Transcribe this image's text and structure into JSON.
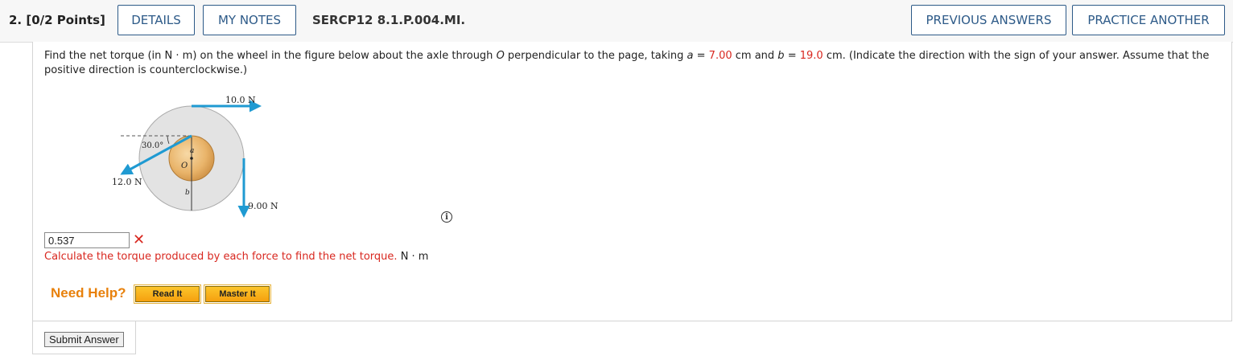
{
  "header": {
    "question_number": "2.",
    "points": "[0/2 Points]",
    "details_label": "DETAILS",
    "my_notes_label": "MY NOTES",
    "problem_code": "SERCP12 8.1.P.004.MI.",
    "previous_answers_label": "PREVIOUS ANSWERS",
    "practice_another_label": "PRACTICE ANOTHER"
  },
  "question": {
    "p1": "Find the net torque (in N · m) on the wheel in the figure below about the axle through ",
    "var_o": "O",
    "p2": " perpendicular to the page, taking ",
    "var_a": "a",
    "p3": " = ",
    "a_value": "7.00",
    "p4": " cm and ",
    "var_b": "b",
    "p5": " = ",
    "b_value": "19.0",
    "p6": " cm. (Indicate the direction with the sign of your answer. Assume that the positive direction is counterclockwise.)"
  },
  "figure": {
    "force_top": "10.0 N",
    "force_left": "12.0 N",
    "force_right": "9.00 N",
    "angle": "30.0°",
    "label_a": "a",
    "label_b": "b",
    "label_o": "O"
  },
  "answer": {
    "value": "0.537",
    "status": "incorrect",
    "feedback": "Calculate the torque produced by each force to find the net torque.",
    "unit": "N · m"
  },
  "help": {
    "label": "Need Help?",
    "read_it": "Read It",
    "master_it": "Master It"
  },
  "submit_label": "Submit Answer",
  "icons": {
    "info": "info-icon",
    "incorrect": "x-mark-icon"
  },
  "colors": {
    "accent_blue": "#2d5a88",
    "error_red": "#d8271f",
    "help_orange": "#e8810c",
    "arrow_blue": "#1f9ad2"
  }
}
